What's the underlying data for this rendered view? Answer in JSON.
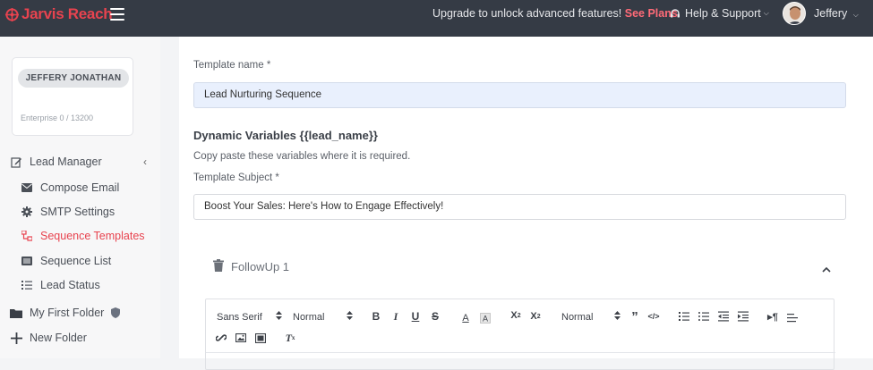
{
  "topbar": {
    "brand": "Jarvis Reach",
    "upgrade_text": "Upgrade to unlock advanced features!",
    "see_plans": "See Plans",
    "help": "Help & Support",
    "user": "Jeffery"
  },
  "sidebar": {
    "profile_name": "JEFFERY JONATHAN",
    "plan": "Enterprise 0 / 13200",
    "items": [
      {
        "label": "Lead Manager"
      },
      {
        "label": "Compose Email"
      },
      {
        "label": "SMTP Settings"
      },
      {
        "label": "Sequence Templates"
      },
      {
        "label": "Sequence List"
      },
      {
        "label": "Lead Status"
      },
      {
        "label": "My First Folder"
      },
      {
        "label": "New Folder"
      }
    ]
  },
  "form": {
    "template_name_label": "Template name *",
    "template_name_value": "Lead Nurturing Sequence",
    "dynamic_heading": "Dynamic Variables {{lead_name}}",
    "dynamic_help": "Copy paste these variables where it is required.",
    "subject_label": "Template Subject *",
    "subject_value": "Boost Your Sales: Here's How to Engage Effectively!",
    "followup_label": "FollowUp 1"
  },
  "editor": {
    "font": "Sans Serif",
    "size": "Normal",
    "heading": "Normal"
  },
  "colors": {
    "accent": "#e8434f",
    "topbar": "#353b45"
  }
}
